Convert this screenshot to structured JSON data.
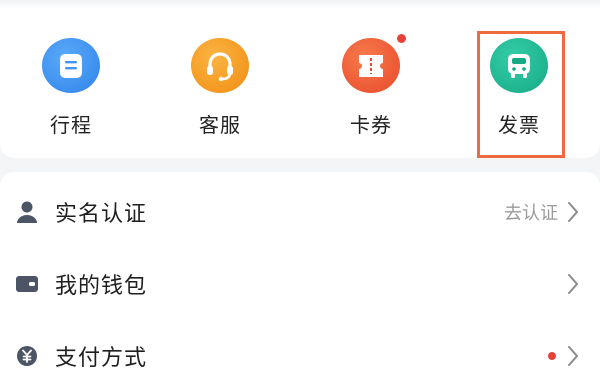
{
  "shortcuts": {
    "trip": {
      "label": "行程",
      "icon": "document-icon",
      "color": "#3f93f2"
    },
    "service": {
      "label": "客服",
      "icon": "headset-icon",
      "color": "#f39a1e"
    },
    "coupon": {
      "label": "卡券",
      "icon": "ticket-icon",
      "color": "#ef5a2f",
      "badge": true
    },
    "invoice": {
      "label": "发票",
      "icon": "vehicle-icon",
      "color": "#1fb896",
      "highlighted": true
    }
  },
  "menu": {
    "verify": {
      "label": "实名认证",
      "hint": "去认证",
      "icon": "person-icon"
    },
    "wallet": {
      "label": "我的钱包",
      "icon": "wallet-icon"
    },
    "payment": {
      "label": "支付方式",
      "icon": "yuan-icon",
      "badge": true
    }
  },
  "colors": {
    "highlight_border": "#ef6a3f",
    "badge": "#e8403b",
    "menu_icon": "#4b5565"
  }
}
